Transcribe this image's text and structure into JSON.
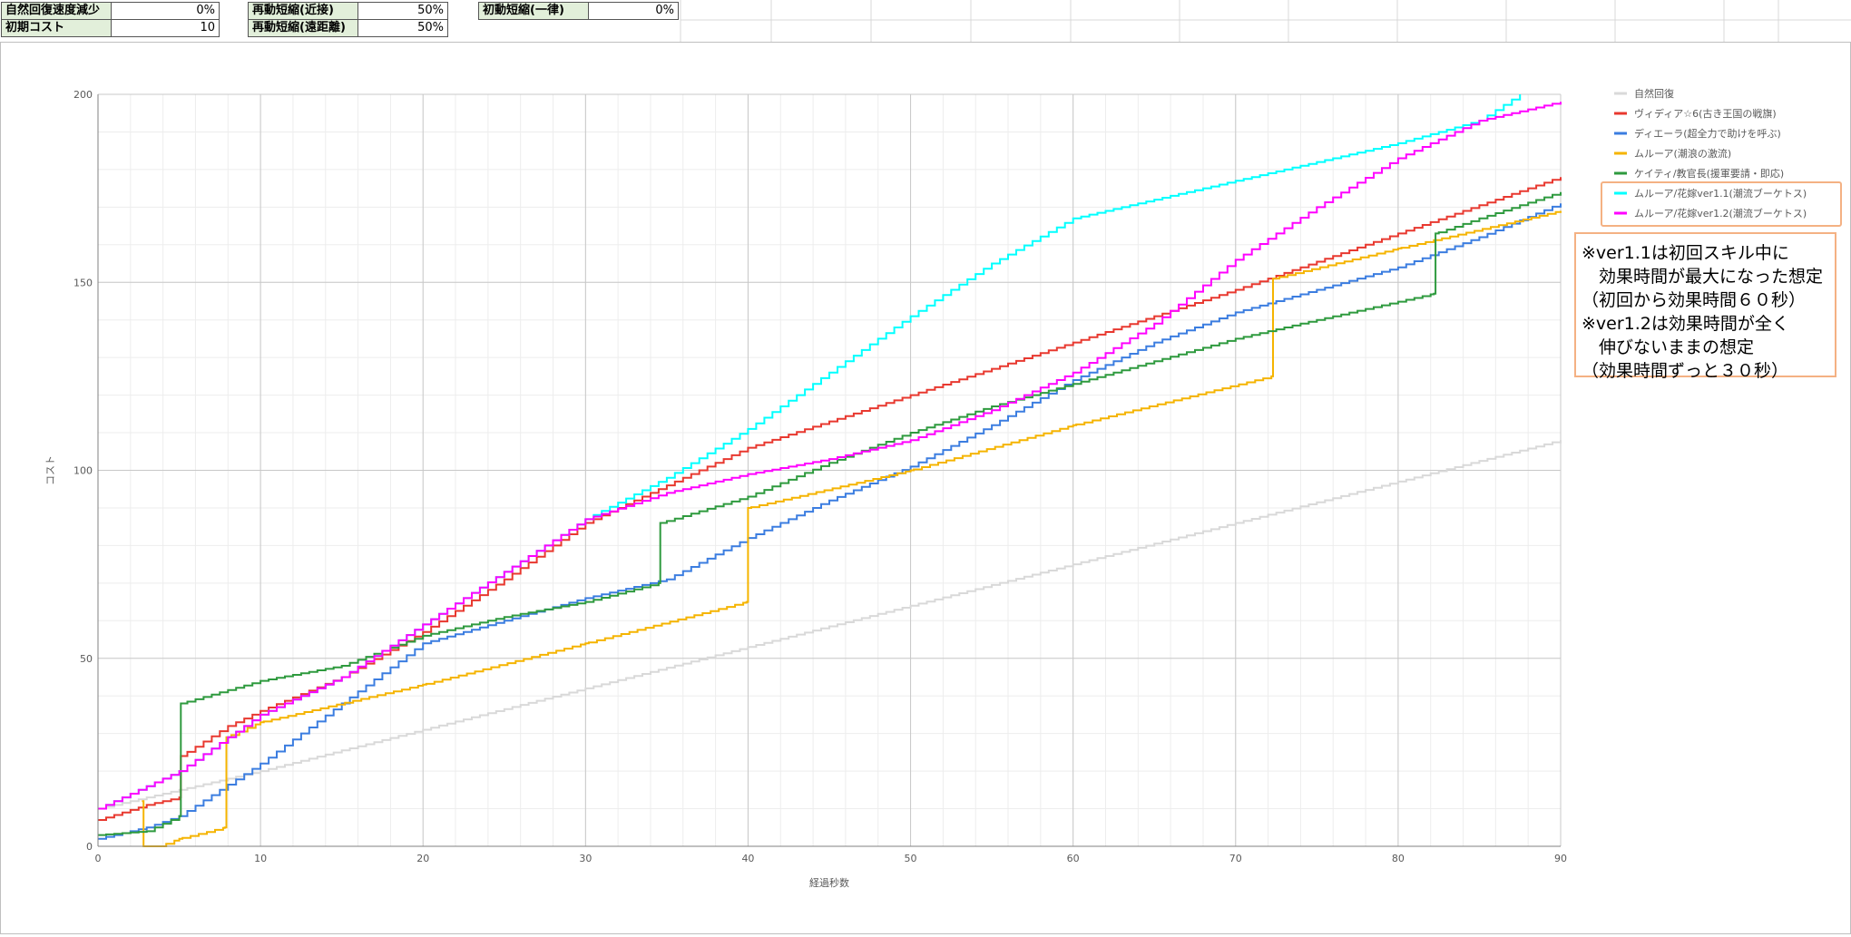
{
  "params": [
    {
      "label": "自然回復速度減少",
      "value": "0%"
    },
    {
      "label": "初期コスト",
      "value": "10"
    },
    {
      "label": "再動短縮(近接)",
      "value": "50%"
    },
    {
      "label": "再動短縮(遠距離)",
      "value": "50%"
    },
    {
      "label": "初動短縮(一律)",
      "value": "0%"
    }
  ],
  "note_lines": [
    "※ver1.1は初回スキル中に",
    "　効果時間が最大になった想定",
    "（初回から効果時間６０秒）",
    "※ver1.2は効果時間が全く",
    "　伸びないままの想定",
    "（効果時間ずっと３０秒）"
  ],
  "colors": {
    "natural": "#d9d9d9",
    "red": "#e8382f",
    "blue": "#3b7de0",
    "orange": "#f5b400",
    "green": "#2e9a3e",
    "cyan": "#00ffff",
    "magenta": "#ff00ff",
    "highlight_border": "#f4b183",
    "param_label_bg": "#e2efda"
  },
  "chart_data": {
    "type": "line",
    "xlabel": "経過秒数",
    "ylabel": "コスト",
    "xlim": [
      0,
      90
    ],
    "ylim": [
      0,
      200
    ],
    "xticks": [
      0,
      10,
      20,
      30,
      40,
      50,
      60,
      70,
      80,
      90
    ],
    "yticks": [
      0,
      50,
      100,
      150,
      200
    ],
    "grid": true,
    "legend_position": "right",
    "step_style": "stair",
    "series": [
      {
        "name": "自然回復",
        "color": "#d9d9d9",
        "points": [
          [
            0,
            10
          ],
          [
            10,
            20
          ],
          [
            20,
            31
          ],
          [
            30,
            42
          ],
          [
            40,
            53
          ],
          [
            50,
            64
          ],
          [
            60,
            75
          ],
          [
            70,
            86
          ],
          [
            80,
            97
          ],
          [
            90,
            108
          ]
        ]
      },
      {
        "name": "ヴィディア☆6(古き王国の戦旗)",
        "color": "#e8382f",
        "points": [
          [
            0,
            7
          ],
          [
            3,
            11
          ],
          [
            5,
            13
          ],
          [
            5.1,
            24
          ],
          [
            8,
            32
          ],
          [
            10,
            36
          ],
          [
            15,
            45
          ],
          [
            20,
            57
          ],
          [
            25,
            71
          ],
          [
            30,
            86
          ],
          [
            35,
            96
          ],
          [
            40,
            106
          ],
          [
            50,
            120
          ],
          [
            60,
            134
          ],
          [
            70,
            148
          ],
          [
            80,
            163
          ],
          [
            90,
            178
          ]
        ]
      },
      {
        "name": "ディエーラ(超全力で助けを呼ぶ)",
        "color": "#3b7de0",
        "points": [
          [
            0,
            2
          ],
          [
            3,
            5
          ],
          [
            5,
            8
          ],
          [
            10,
            22
          ],
          [
            15,
            38
          ],
          [
            20,
            54
          ],
          [
            25,
            60
          ],
          [
            30,
            66
          ],
          [
            35,
            71
          ],
          [
            40,
            82
          ],
          [
            45,
            92
          ],
          [
            50,
            101
          ],
          [
            55,
            112
          ],
          [
            60,
            124
          ],
          [
            65,
            134
          ],
          [
            70,
            142
          ],
          [
            75,
            148
          ],
          [
            80,
            154
          ],
          [
            85,
            162
          ],
          [
            90,
            171
          ]
        ]
      },
      {
        "name": "ムルーア(潮浪の激流)",
        "color": "#f5b400",
        "points": [
          [
            2.7,
            12
          ],
          [
            2.8,
            0
          ],
          [
            3.8,
            0
          ],
          [
            5,
            2
          ],
          [
            7.8,
            5
          ],
          [
            7.9,
            29
          ],
          [
            10,
            33
          ],
          [
            20,
            43
          ],
          [
            30,
            54
          ],
          [
            39.9,
            65
          ],
          [
            40,
            90
          ],
          [
            50,
            100
          ],
          [
            60,
            112
          ],
          [
            72.2,
            125
          ],
          [
            72.3,
            151
          ],
          [
            80,
            159
          ],
          [
            90,
            169
          ]
        ]
      },
      {
        "name": "ケイティ/教官長(援軍要請・即応)",
        "color": "#2e9a3e",
        "points": [
          [
            0,
            3
          ],
          [
            3,
            4
          ],
          [
            5,
            8
          ],
          [
            5.1,
            38
          ],
          [
            10,
            44
          ],
          [
            15,
            48
          ],
          [
            20,
            56
          ],
          [
            25,
            61
          ],
          [
            30,
            65
          ],
          [
            34.5,
            70
          ],
          [
            34.6,
            86
          ],
          [
            40,
            93
          ],
          [
            45,
            102
          ],
          [
            50,
            110
          ],
          [
            55,
            117
          ],
          [
            60,
            123
          ],
          [
            65,
            129
          ],
          [
            70,
            135
          ],
          [
            75,
            140
          ],
          [
            82.2,
            147
          ],
          [
            82.3,
            163
          ],
          [
            85,
            167
          ],
          [
            90,
            174
          ]
        ]
      },
      {
        "name": "ムルーア/花嫁ver1.1(潮流ブーケトス)",
        "color": "#00ffff",
        "points": [
          [
            0,
            10
          ],
          [
            5,
            20
          ],
          [
            10,
            35
          ],
          [
            15,
            45
          ],
          [
            20,
            59
          ],
          [
            25,
            73
          ],
          [
            30,
            87
          ],
          [
            35,
            98
          ],
          [
            40,
            111
          ],
          [
            45,
            126
          ],
          [
            50,
            141
          ],
          [
            55,
            155
          ],
          [
            60,
            167
          ],
          [
            65,
            172
          ],
          [
            70,
            177
          ],
          [
            75,
            182
          ],
          [
            80,
            187
          ],
          [
            85,
            193
          ],
          [
            87.5,
            200
          ]
        ]
      },
      {
        "name": "ムルーア/花嫁ver1.2(潮流ブーケトス)",
        "color": "#ff00ff",
        "points": [
          [
            0,
            10
          ],
          [
            5,
            20
          ],
          [
            10,
            35
          ],
          [
            15,
            45
          ],
          [
            20,
            59
          ],
          [
            25,
            73
          ],
          [
            30,
            87
          ],
          [
            35,
            94
          ],
          [
            40,
            99
          ],
          [
            45,
            103
          ],
          [
            50,
            108
          ],
          [
            55,
            116
          ],
          [
            60,
            126
          ],
          [
            65,
            139
          ],
          [
            70,
            156
          ],
          [
            75,
            170
          ],
          [
            80,
            183
          ],
          [
            85,
            193
          ],
          [
            90,
            198
          ]
        ]
      }
    ]
  }
}
